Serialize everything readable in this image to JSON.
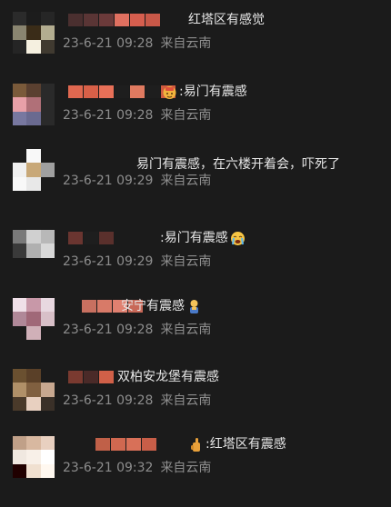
{
  "comments": [
    {
      "text": "红塔区有感觉",
      "time": "23-6-21 09:28",
      "source": "来自云南",
      "emoji": "",
      "avatar_colors": [
        "#2b2b2b",
        "#1c1c1c",
        "#262626",
        "#8a8570",
        "#3a2c18",
        "#b3ad90",
        "#252525",
        "#f5f0e0",
        "#403a30"
      ],
      "name_colors": [
        "#4a2f2f",
        "#5a3535",
        "#6b3a3a",
        "#e07060",
        "#d65e4e",
        "#c85848"
      ]
    },
    {
      "text": ":易门有震感",
      "time": "23-6-21 09:28",
      "source": "来自云南",
      "emoji": "emoji-icon",
      "avatar_colors": [
        "#7a5a3a",
        "#5a4030",
        "#2a2a2a",
        "#e8a0a8",
        "#b07078",
        "#2a2a2a",
        "#7878a0",
        "#6a6a90",
        "#2a2a2a"
      ],
      "name_colors": [
        "#e06850",
        "#d86048",
        "#e87058",
        "#1e1e1e",
        "#e07a60",
        "#1e1e1e",
        "#d05a40"
      ]
    },
    {
      "text": "易门有震感，在六楼开着会，吓死了",
      "time": "23-6-21 09:29",
      "source": "来自云南",
      "emoji": "",
      "avatar_colors": [
        "#1b1b1b",
        "#f8f8f8",
        "#1b1b1b",
        "#f0f0f0",
        "#c8a878",
        "#a0a0a0",
        "#f8f8f8",
        "#e8e8e8",
        "#1b1b1b"
      ],
      "name_colors": []
    },
    {
      "text": ":易门有震感",
      "time": "23-6-21 09:29",
      "source": "来自云南",
      "emoji": "crying-emoji-icon",
      "avatar_colors": [
        "#7a7a7a",
        "#d0d0d0",
        "#b8b8b8",
        "#3a3a3a",
        "#b0b0b0",
        "#d8d8d8",
        "#1b1b1b",
        "#1b1b1b",
        "#1b1b1b"
      ],
      "name_colors": [
        "#6a3530",
        "#1e1e1e",
        "#5a302c"
      ]
    },
    {
      "text": "安宁有震感",
      "time": "23-6-21 09:28",
      "source": "来自云南",
      "emoji": "person-emoji-icon",
      "avatar_colors": [
        "#f0e0e8",
        "#c898a8",
        "#e8d8e0",
        "#b08898",
        "#a06878",
        "#d8c0c8",
        "#1b1b1b",
        "#d0b0b8",
        "#1b1b1b"
      ],
      "name_colors": [
        "#c87060",
        "#d87a68",
        "#e08070",
        "#c86858"
      ]
    },
    {
      "text": "双柏安龙堡有震感",
      "time": "23-6-21 09:28",
      "source": "来自云南",
      "emoji": "",
      "avatar_colors": [
        "#6a5030",
        "#5a4028",
        "#1b1b1b",
        "#b09068",
        "#806040",
        "#c8a890",
        "#4a3a2a",
        "#e8d0c0",
        "#3a3028"
      ],
      "name_colors": [
        "#7a3a30",
        "#4a2a28",
        "#d06048"
      ]
    },
    {
      "text": ":红塔区有震感",
      "time": "23-6-21 09:32",
      "source": "来自云南",
      "emoji": "hand-emoji-icon",
      "avatar_colors": [
        "#c0a088",
        "#d8b8a0",
        "#e8d0c0",
        "#f0e8e0",
        "#f8f0e8",
        "#ffffff",
        "#200000",
        "#f0e0d0",
        "#fff8f0"
      ],
      "name_colors": [
        "#c06048",
        "#d06850",
        "#d87058",
        "#c85e48"
      ]
    }
  ]
}
